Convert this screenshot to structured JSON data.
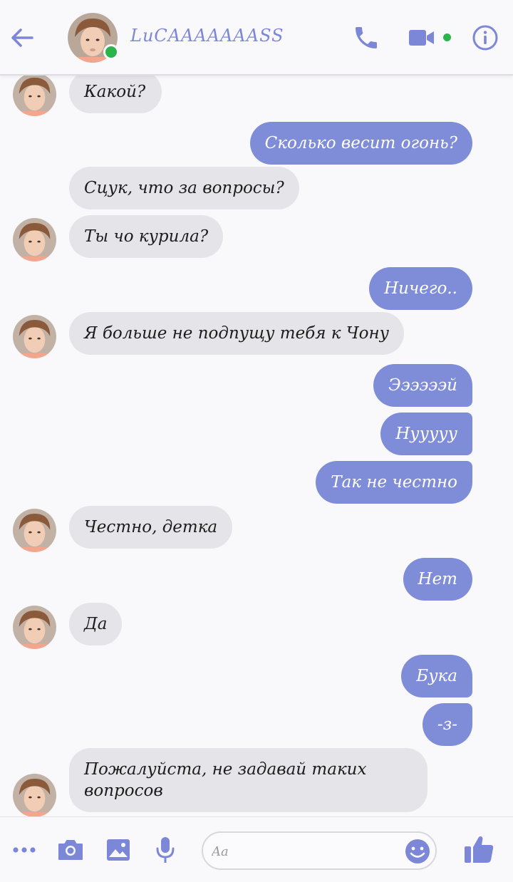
{
  "header": {
    "contact_name": "LuCAAAAAAASS",
    "status_color": "#2cb44c",
    "accent": "#7d87d8",
    "icons": [
      "back-arrow-icon",
      "phone-icon",
      "video-camera-icon",
      "info-icon"
    ]
  },
  "messages": [
    {
      "side": "in",
      "text": "Какой?"
    },
    {
      "side": "out",
      "text": "Сколько весит огонь?"
    },
    {
      "side": "in",
      "text": "Сцук, что за вопросы?"
    },
    {
      "side": "in",
      "text": "Ты чо курила?"
    },
    {
      "side": "out",
      "text": "Ничего.."
    },
    {
      "side": "in",
      "text": "Я больше не подпущу тебя к Чону"
    },
    {
      "side": "out",
      "text": "Ээээээй"
    },
    {
      "side": "out",
      "text": "Нууууу"
    },
    {
      "side": "out",
      "text": "Так не честно"
    },
    {
      "side": "in",
      "text": "Честно, детка"
    },
    {
      "side": "out",
      "text": "Нет"
    },
    {
      "side": "in",
      "text": "Да"
    },
    {
      "side": "out",
      "text": "Бука"
    },
    {
      "side": "out",
      "text": "-з-"
    },
    {
      "side": "in",
      "text": "Пожалуйста, не задавай таких вопросов"
    }
  ],
  "composer": {
    "placeholder": "Aa",
    "icons": [
      "more-icon",
      "camera-icon",
      "image-icon",
      "microphone-icon",
      "emoji-icon",
      "thumbs-up-icon"
    ]
  },
  "colors": {
    "incoming_bubble": "#e5e4e9",
    "outgoing_bubble": "#7f8dd8",
    "icon": "#7d87d8"
  }
}
